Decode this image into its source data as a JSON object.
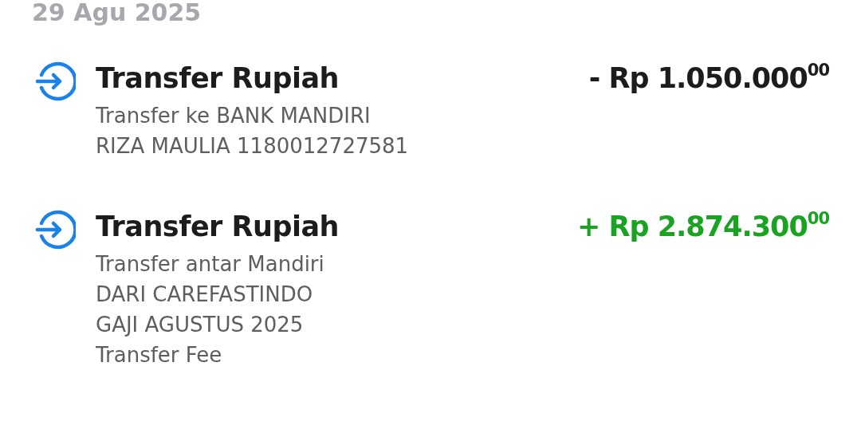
{
  "date": "29 Agu 2025",
  "transactions": [
    {
      "title": "Transfer Rupiah",
      "kind": "debit",
      "amount": "- Rp 1.050.000$^{00}$",
      "details": [
        "Transfer ke BANK MANDIRI",
        "RIZA MAULIA 1180012727581"
      ]
    },
    {
      "title": "Transfer Rupiah",
      "kind": "credit",
      "amount": "+ Rp 2.874.300$^{00}$",
      "details": [
        "Transfer antar Mandiri",
        "DARI CAREFASTINDO",
        "GAJI AGUSTUS 2025",
        "Transfer Fee"
      ]
    }
  ]
}
